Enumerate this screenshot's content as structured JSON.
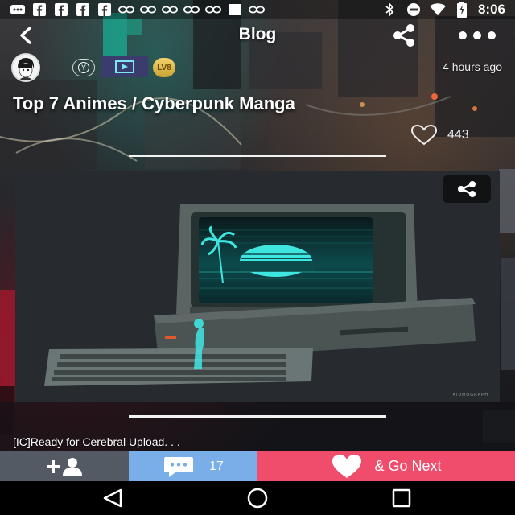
{
  "status_bar": {
    "time": "8:06",
    "icons_left": [
      "message-icon",
      "facebook-icon",
      "facebook-icon",
      "facebook-icon",
      "facebook-icon",
      "glasses-icon",
      "glasses-icon",
      "glasses-icon",
      "glasses-icon",
      "glasses-icon",
      "square-icon",
      "glasses-icon"
    ],
    "icons_right": [
      "bluetooth-icon",
      "do-not-disturb-icon",
      "wifi-icon",
      "battery-charging-icon"
    ]
  },
  "header": {
    "title": "Blog",
    "back_icon": "back-arrow-icon",
    "share_icon": "share-icon",
    "more_icon": "more-dots-icon"
  },
  "author": {
    "avatar_icon": "avatar-icon",
    "badge_text": "Y",
    "level": "LV8",
    "timestamp": "4 hours ago"
  },
  "post": {
    "title": "Top 7 Animes / Cyberpunk Manga",
    "likes": "443",
    "excerpt": "[IC]Ready for Cerebral Upload. . ."
  },
  "image_card": {
    "description_icon": "retro-computer-image",
    "share_icon": "share-icon",
    "watermark": "KIDMOGRAPH"
  },
  "action_bar": {
    "follow_icon": "add-user-icon",
    "comment_icon": "comment-icon",
    "comment_count": "17",
    "next_icon": "heart-icon",
    "next_label": "& Go Next"
  },
  "nav_bar": {
    "back_icon": "nav-back-icon",
    "home_icon": "nav-home-icon",
    "recents_icon": "nav-recents-icon"
  },
  "colors": {
    "follow": "#545a63",
    "comment": "#7aaee9",
    "next": "#f04c6c",
    "screen_glow": "#3fe6e0"
  }
}
